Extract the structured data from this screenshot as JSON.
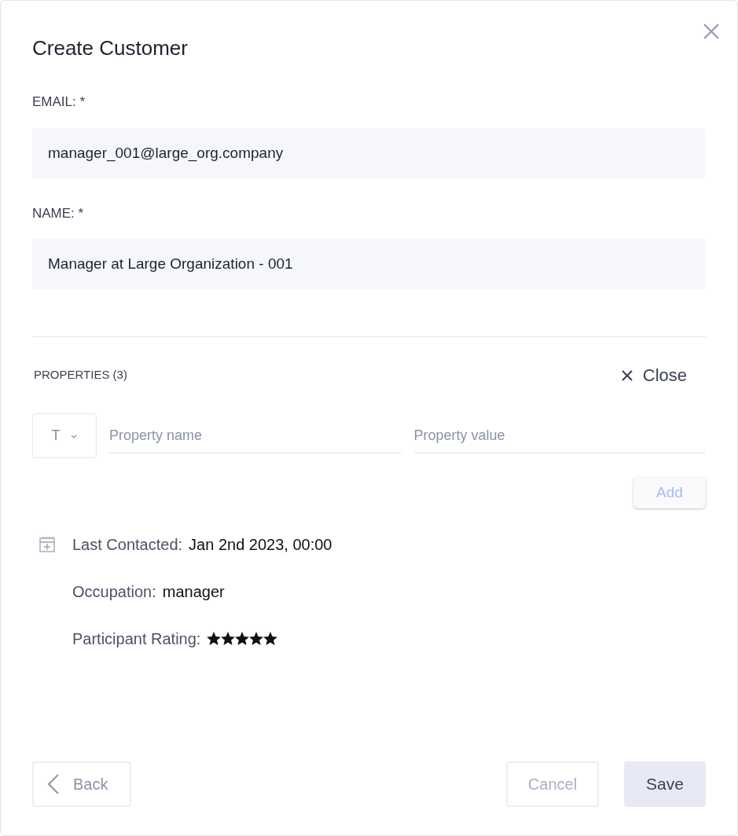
{
  "dialog": {
    "title": "Create Customer"
  },
  "fields": [
    {
      "label": "EMAIL: *",
      "value": "manager_001@large_org.company"
    },
    {
      "label": "NAME: *",
      "value": "Manager at Large Organization - 001"
    }
  ],
  "properties": {
    "heading": "PROPERTIES (3)",
    "close_label": "Close",
    "type_select": "T",
    "name_placeholder": "Property name",
    "value_placeholder": "Property value",
    "add_button": {
      "label": "Add",
      "disabled": true
    },
    "items": [
      {
        "kind": "date",
        "label": "Last Contacted:",
        "value": "Jan 2nd 2023, 00:00"
      },
      {
        "kind": "text",
        "label": "Occupation:",
        "value": "manager"
      },
      {
        "kind": "rating",
        "label": "Participant Rating:",
        "stars": 5
      }
    ]
  },
  "footer": {
    "back": "Back",
    "cancel": {
      "label": "Cancel",
      "disabled": true
    },
    "save": {
      "label": "Save",
      "disabled": false
    }
  }
}
